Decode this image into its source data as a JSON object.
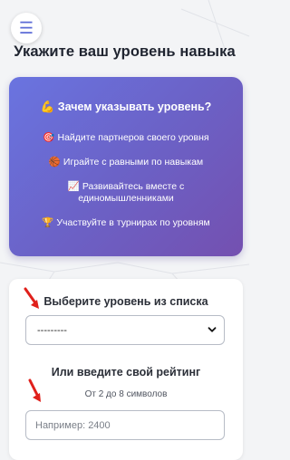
{
  "header": {
    "menu_icon": "menu-icon",
    "title": "Укажите ваш уровень навыка"
  },
  "info": {
    "heading_icon": "💪",
    "heading": "Зачем указывать уровень?",
    "items": [
      {
        "icon": "🎯",
        "text": "Найдите партнеров своего уровня"
      },
      {
        "icon": "🏀",
        "text": "Играйте с равными по навыкам"
      },
      {
        "icon": "📈",
        "text_line1": "Развивайтесь вместе с",
        "text_line2": "единомышленниками"
      },
      {
        "icon": "🏆",
        "text": "Участвуйте в турнирах по уровням"
      }
    ]
  },
  "form": {
    "select_label": "Выберите уровень из списка",
    "select_value": "---------",
    "rating_label": "Или введите свой рейтинг",
    "rating_hint": "От 2 до 8 символов",
    "rating_placeholder": "Например: 2400",
    "rating_value": ""
  },
  "colors": {
    "accent": "#5b6bd6",
    "card_gradient_start": "#6a74e0",
    "card_gradient_end": "#7450b0",
    "arrow": "#e0201b"
  }
}
